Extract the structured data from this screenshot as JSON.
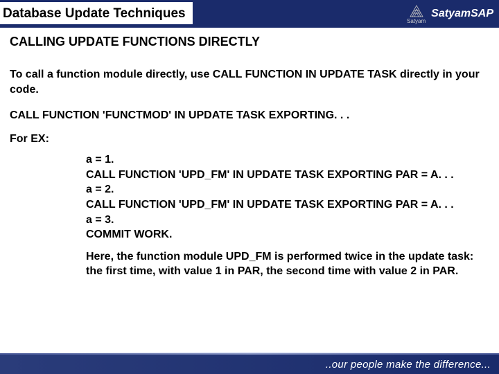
{
  "header": {
    "title": "Database Update Techniques",
    "logo_small_text": "Satyam",
    "logo_text": "Satyam",
    "logo_sap": "SAP"
  },
  "content": {
    "subtitle": "CALLING UPDATE FUNCTIONS DIRECTLY",
    "intro": "To call a function module directly, use CALL FUNCTION IN UPDATE TASK directly in your code.",
    "syntax": "CALL FUNCTION 'FUNCTMOD' IN UPDATE TASK EXPORTING. . .",
    "forex_label": "For EX:",
    "code": "a = 1.\nCALL FUNCTION 'UPD_FM' IN UPDATE TASK EXPORTING PAR = A. . .\na = 2.\nCALL FUNCTION 'UPD_FM' IN UPDATE TASK EXPORTING PAR = A. . .\na = 3.\nCOMMIT WORK.",
    "explain": "Here, the function module UPD_FM is performed twice in the update task: the first time, with value 1 in PAR, the second time with value 2 in PAR."
  },
  "footer": {
    "tagline": "..our people make the difference..."
  }
}
